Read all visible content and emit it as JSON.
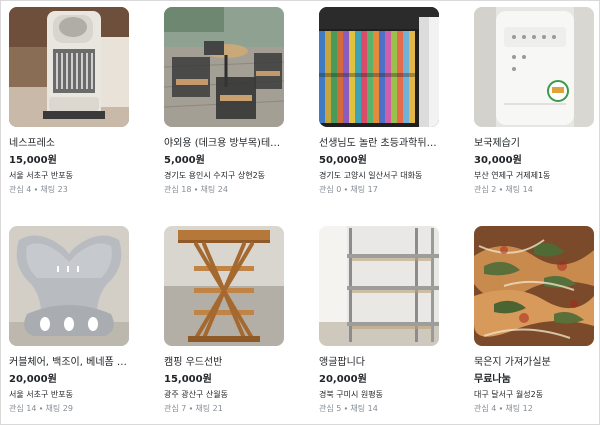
{
  "products": [
    {
      "title": "네스프레소",
      "price": "15,000원",
      "region": "서울 서초구 반포동",
      "likes_label": "관심",
      "likes": "4",
      "chats_label": "채팅",
      "chats": "23",
      "image_icon": "espresso-machine-icon"
    },
    {
      "title": "야외용 (데크용 방부목)테이...",
      "price": "5,000원",
      "region": "경기도 용인시 수지구 상현2동",
      "likes_label": "관심",
      "likes": "18",
      "chats_label": "채팅",
      "chats": "24",
      "image_icon": "patio-table-icon"
    },
    {
      "title": "선생님도 놀란 초등과학뒤집기",
      "price": "50,000원",
      "region": "경기도 고양시 일산서구 대화동",
      "likes_label": "관심",
      "likes": "0",
      "chats_label": "채팅",
      "chats": "17",
      "image_icon": "bookshelf-icon"
    },
    {
      "title": "보국제습기",
      "price": "30,000원",
      "region": "부산 연제구 거제제1동",
      "likes_label": "관심",
      "likes": "2",
      "chats_label": "채팅",
      "chats": "14",
      "image_icon": "dehumidifier-icon"
    },
    {
      "title": "커블체어, 백조이, 베네폼 등...",
      "price": "20,000원",
      "region": "서울 서초구 반포동",
      "likes_label": "관심",
      "likes": "14",
      "chats_label": "채팅",
      "chats": "29",
      "image_icon": "posture-chair-icon"
    },
    {
      "title": "캠핑 우드선반",
      "price": "15,000원",
      "region": "광주 광산구 산월동",
      "likes_label": "관심",
      "likes": "7",
      "chats_label": "채팅",
      "chats": "21",
      "image_icon": "wood-shelf-icon"
    },
    {
      "title": "앵글팝니다",
      "price": "20,000원",
      "region": "경북 구미시 원평동",
      "likes_label": "관심",
      "likes": "5",
      "chats_label": "채팅",
      "chats": "14",
      "image_icon": "metal-rack-icon"
    },
    {
      "title": "묵은지 가져가실분",
      "price": "무료나눔",
      "region": "대구 달서구 월성2동",
      "likes_label": "관심",
      "likes": "4",
      "chats_label": "채팅",
      "chats": "12",
      "image_icon": "kimchi-icon"
    }
  ]
}
